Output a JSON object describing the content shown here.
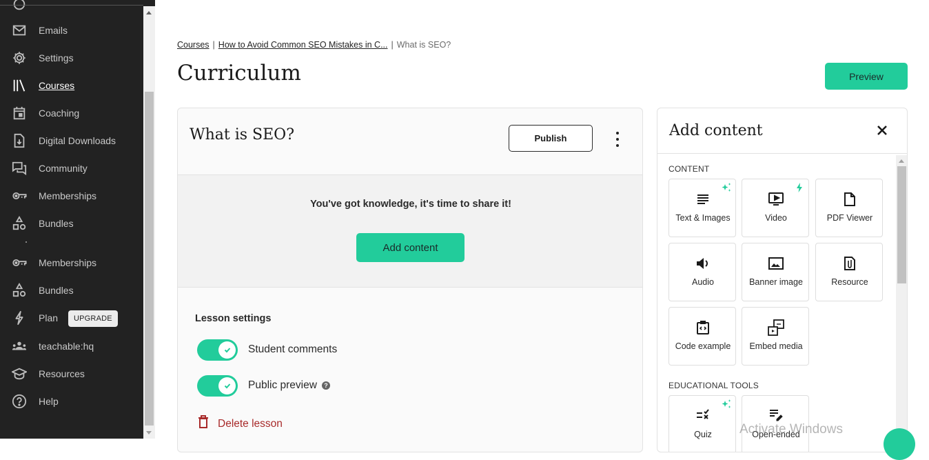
{
  "sidebar": {
    "items": [
      {
        "label": "",
        "icon": "partial-icon"
      },
      {
        "label": "Emails",
        "icon": "mail-icon"
      },
      {
        "label": "Settings",
        "icon": "gear-icon"
      },
      {
        "label": "Courses",
        "icon": "library-icon",
        "active": true
      },
      {
        "label": "Coaching",
        "icon": "calendar-icon"
      },
      {
        "label": "Digital Downloads",
        "icon": "file-download-icon"
      },
      {
        "label": "Community",
        "icon": "chat-bubbles-icon"
      },
      {
        "label": "Memberships",
        "icon": "key-icon"
      },
      {
        "label": "Bundles",
        "icon": "shapes-icon"
      },
      {
        "label": "Memberships",
        "icon": "key-icon"
      },
      {
        "label": "Bundles",
        "icon": "shapes-icon"
      },
      {
        "label": "Plan",
        "icon": "lightning-icon",
        "badge": "UPGRADE"
      },
      {
        "label": "teachable:hq",
        "icon": "people-icon"
      },
      {
        "label": "Resources",
        "icon": "graduation-cap-icon"
      },
      {
        "label": "Help",
        "icon": "help-circle-icon"
      }
    ]
  },
  "breadcrumb": {
    "items": [
      "Courses",
      "How to Avoid Common SEO Mistakes in C...",
      "What is SEO?"
    ],
    "separator": "|"
  },
  "page": {
    "title": "Curriculum",
    "preview_label": "Preview"
  },
  "lesson": {
    "title": "What is SEO?",
    "publish_label": "Publish",
    "empty_message": "You've got knowledge, it's time to share it!",
    "add_content_label": "Add content",
    "settings_title": "Lesson settings",
    "toggles": [
      {
        "label": "Student comments",
        "on": true
      },
      {
        "label": "Public preview",
        "on": true,
        "help": "?"
      }
    ],
    "delete_label": "Delete lesson"
  },
  "panel": {
    "title": "Add content",
    "sections": [
      {
        "label": "CONTENT",
        "tiles": [
          {
            "label": "Text & Images",
            "icon": "text-lines-icon",
            "badge": "ai-sparkle-icon"
          },
          {
            "label": "Video",
            "icon": "video-icon",
            "badge": "lightning-icon"
          },
          {
            "label": "PDF Viewer",
            "icon": "document-icon"
          },
          {
            "label": "Audio",
            "icon": "speaker-icon"
          },
          {
            "label": "Banner image",
            "icon": "image-icon"
          },
          {
            "label": "Resource",
            "icon": "attachment-icon"
          },
          {
            "label": "Code example",
            "icon": "code-icon"
          },
          {
            "label": "Embed media",
            "icon": "embed-icon"
          }
        ]
      },
      {
        "label": "EDUCATIONAL TOOLS",
        "tiles": [
          {
            "label": "Quiz",
            "icon": "quiz-icon",
            "badge": "ai-sparkle-icon"
          },
          {
            "label": "Open-ended",
            "icon": "open-ended-icon"
          }
        ]
      }
    ]
  },
  "overlay": {
    "watermark": "Activate Windows"
  },
  "colors": {
    "accent": "#22cc9b",
    "sidebar_bg": "#222222",
    "danger": "#a82a2a"
  }
}
